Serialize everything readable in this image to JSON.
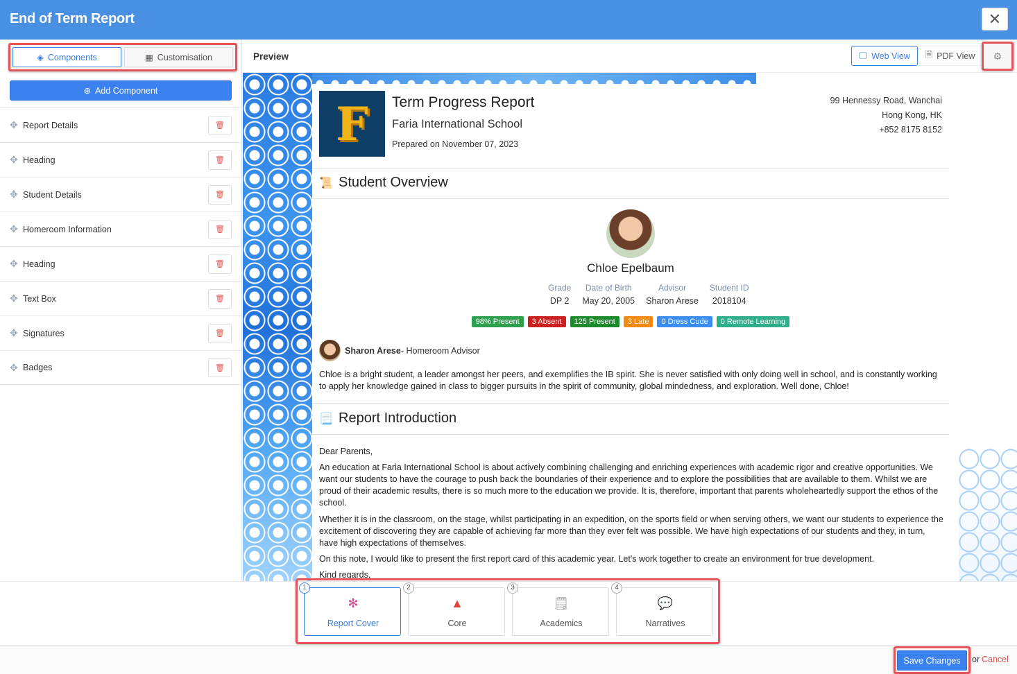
{
  "window": {
    "title": "End of Term Report"
  },
  "left": {
    "tabs": [
      "Components",
      "Customisation"
    ],
    "add_label": "Add Component",
    "components": [
      "Report Details",
      "Heading",
      "Student Details",
      "Homeroom Information",
      "Heading",
      "Text Box",
      "Signatures",
      "Badges"
    ]
  },
  "preview": {
    "label": "Preview",
    "web_view": "Web View",
    "pdf_view": "PDF View"
  },
  "report": {
    "logo_letter": "F",
    "title": "Term Progress Report",
    "school": "Faria International School",
    "prepared": "Prepared on November 07, 2023",
    "address1": "99 Hennessy Road, Wanchai",
    "address2": "Hong Kong, HK",
    "phone": "+852 8175 8152",
    "overview_heading": "Student Overview",
    "student_name": "Chloe Epelbaum",
    "info": [
      {
        "h": "Grade",
        "v": "DP 2"
      },
      {
        "h": "Date of Birth",
        "v": "May 20, 2005"
      },
      {
        "h": "Advisor",
        "v": "Sharon Arese"
      },
      {
        "h": "Student ID",
        "v": "2018104"
      }
    ],
    "badges": [
      {
        "text": "98% Present",
        "color": "#2e9e4f"
      },
      {
        "text": "3 Absent",
        "color": "#cc1f1f"
      },
      {
        "text": "125 Present",
        "color": "#1e8a2e"
      },
      {
        "text": "3 Late",
        "color": "#f08a13"
      },
      {
        "text": "0 Dress Code",
        "color": "#3b8ef0"
      },
      {
        "text": "0 Remote Learning",
        "color": "#2fae8c"
      }
    ],
    "advisor_name": "Sharon Arese",
    "advisor_role": "- Homeroom Advisor",
    "advisor_comment": "Chloe is a bright student, a leader amongst her peers, and exemplifies the IB spirit. She is never satisfied with only doing well in school, and is constantly working to apply her knowledge gained in class to bigger pursuits in the spirit of community, global mindedness, and exploration. Well done, Chloe!",
    "intro_heading": "Report Introduction",
    "greeting": "Dear Parents,",
    "p1": "An education at Faria International School is about actively combining challenging and enriching experiences with academic rigor and creative opportunities. We want our students to have the courage to push back the boundaries of their experience and to explore the possibilities that are available to them. Whilst we are proud of their academic results, there is so much more to the education we provide. It is, therefore, important that parents wholeheartedly support the ethos of the school.",
    "p2": "Whether it is in the classroom, on the stage, whilst participating in an expedition, on the sports field or when serving others, we want our students to experience the excitement of discovering they are capable of achieving far more than they ever felt was possible. We have high expectations of our students and they, in turn, have high expectations of themselves.",
    "p3": "On this note, I would like to present the first report card of this academic year. Let's work together to create an environment for true development.",
    "closing": "Kind regards,"
  },
  "steps": [
    {
      "num": "1",
      "label": "Report Cover",
      "icon": "network-icon"
    },
    {
      "num": "2",
      "label": "Core",
      "icon": "triangle-icon"
    },
    {
      "num": "3",
      "label": "Academics",
      "icon": "document-icon"
    },
    {
      "num": "4",
      "label": "Narratives",
      "icon": "chat-icon"
    }
  ],
  "footer": {
    "save": "Save Changes",
    "or": "or",
    "cancel": "Cancel"
  }
}
